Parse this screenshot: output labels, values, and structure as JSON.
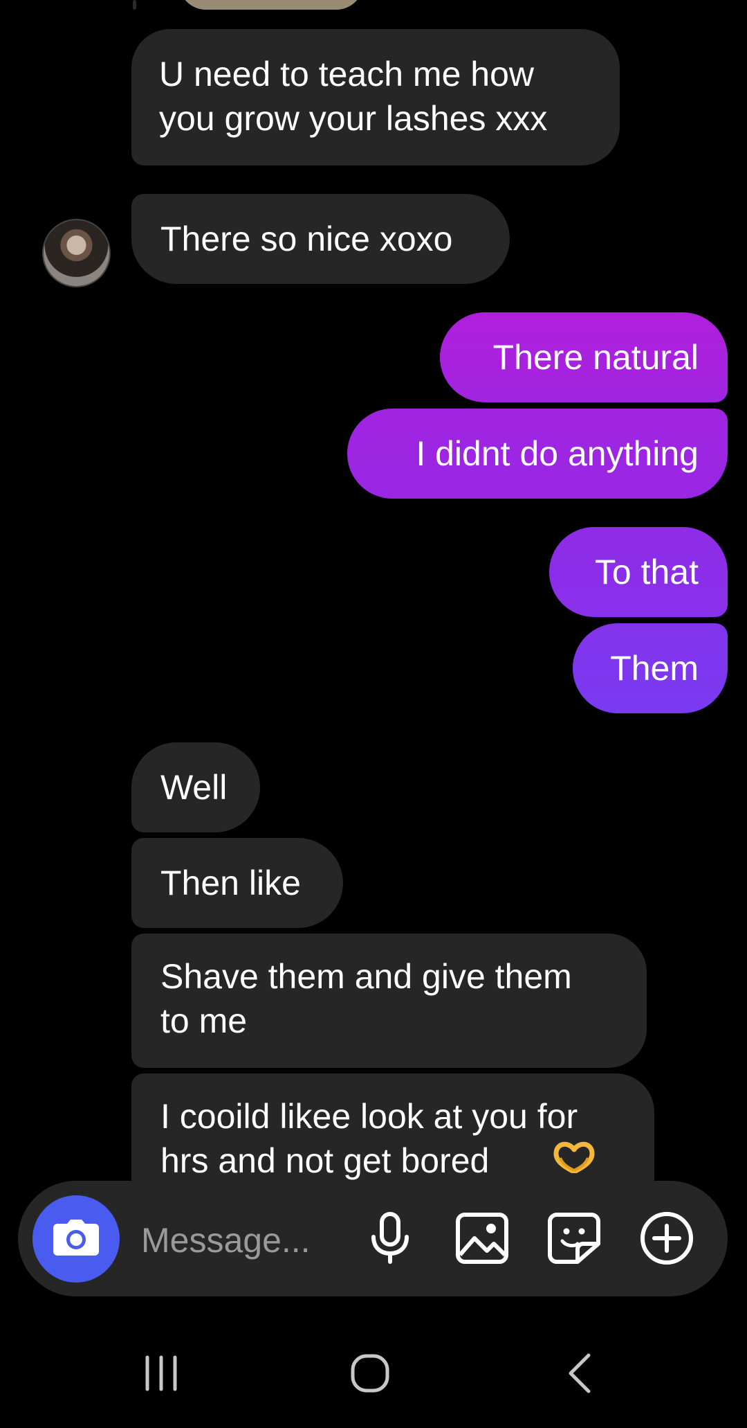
{
  "messages": [
    {
      "text": "U need to teach me how\nyou grow your lashes xxx",
      "direction": "incoming"
    },
    {
      "text": "There so nice xoxo",
      "direction": "incoming"
    },
    {
      "text": "There natural",
      "direction": "outgoing"
    },
    {
      "text": "I didnt do anything",
      "direction": "outgoing"
    },
    {
      "text": "To that",
      "direction": "outgoing"
    },
    {
      "text": "Them",
      "direction": "outgoing"
    },
    {
      "text": "Well",
      "direction": "incoming"
    },
    {
      "text": "Then like",
      "direction": "incoming"
    },
    {
      "text": "Shave them and give them\nto me",
      "direction": "incoming"
    },
    {
      "text": "I cooild likee look at you for\nhrs and not get bored",
      "direction": "incoming",
      "emoji": "heart-hands-emoji"
    }
  ],
  "composer": {
    "placeholder": "Message..."
  },
  "icons": {
    "camera": "camera-icon",
    "microphone": "microphone-icon",
    "gallery": "image-icon",
    "sticker": "sticker-icon",
    "more": "plus-circle-icon"
  },
  "colors": {
    "background": "#000000",
    "incoming_bubble": "#262626",
    "outgoing_gradient_top": "#b11fdc",
    "outgoing_gradient_bottom": "#7a3af0",
    "camera_button": "#4a5cf0"
  }
}
